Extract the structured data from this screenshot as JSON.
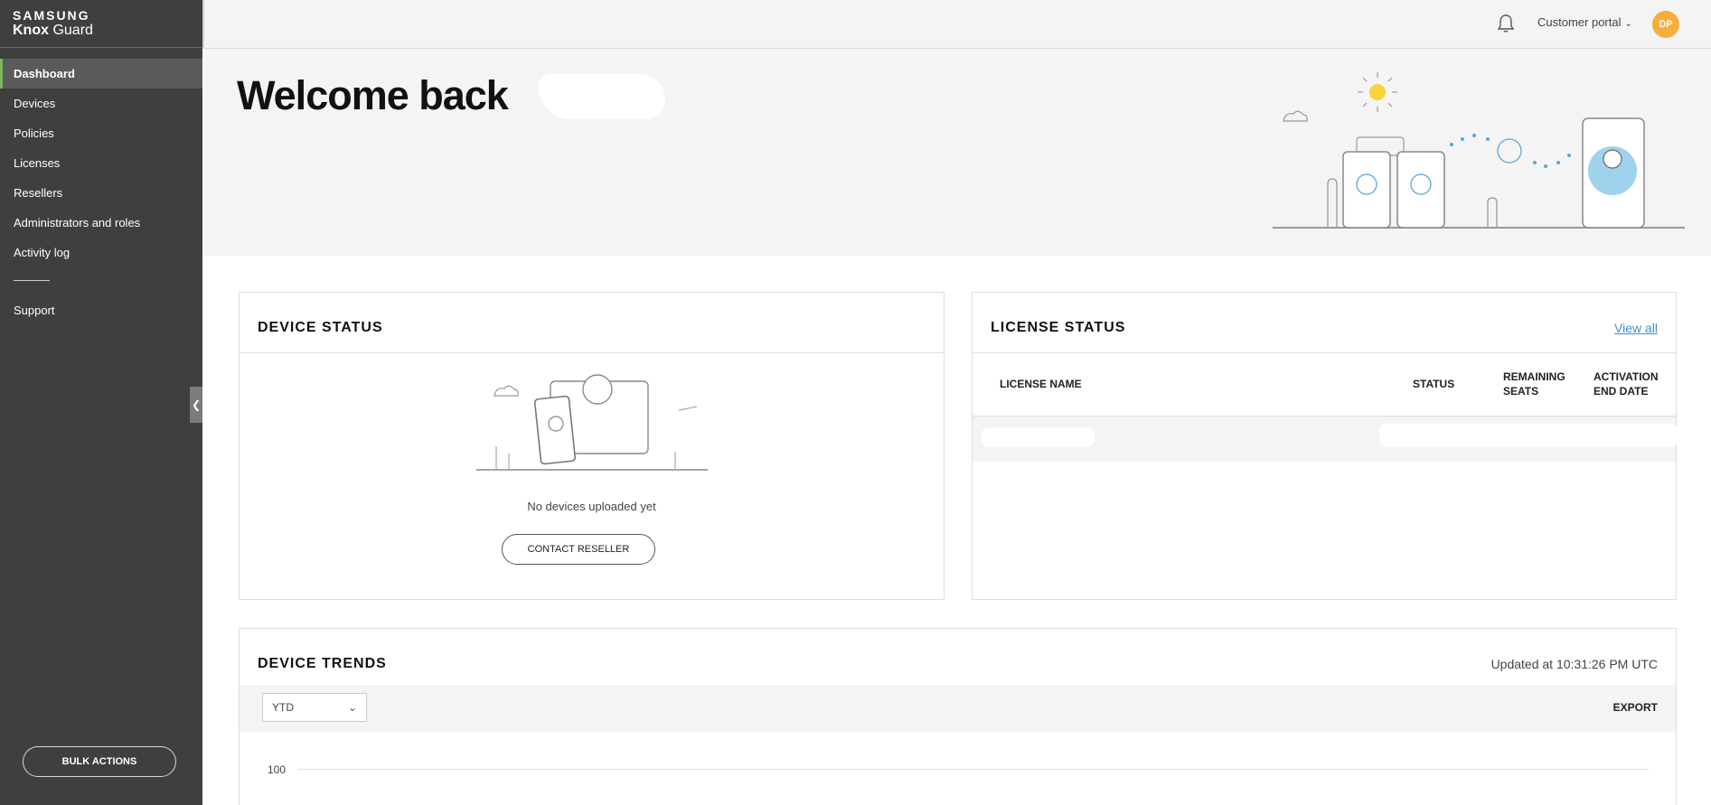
{
  "brand": {
    "top": "SAMSUNG",
    "word1": "Knox",
    "word2": "Guard"
  },
  "sidebar": {
    "items": [
      {
        "label": "Dashboard"
      },
      {
        "label": "Devices"
      },
      {
        "label": "Policies"
      },
      {
        "label": "Licenses"
      },
      {
        "label": "Resellers"
      },
      {
        "label": "Administrators and roles"
      },
      {
        "label": "Activity log"
      },
      {
        "label": "Support"
      }
    ],
    "bulk_actions": "BULK ACTIONS"
  },
  "topbar": {
    "portal": "Customer portal",
    "avatar": "DP"
  },
  "hero": {
    "welcome": "Welcome back"
  },
  "device_status": {
    "title": "DEVICE STATUS",
    "empty_text": "No devices uploaded yet",
    "contact_button": "CONTACT RESELLER"
  },
  "license_status": {
    "title": "LICENSE STATUS",
    "view_all": "View all",
    "columns": [
      "LICENSE NAME",
      "STATUS",
      "REMAINING SEATS",
      "ACTIVATION END DATE"
    ]
  },
  "device_trends": {
    "title": "DEVICE TRENDS",
    "updated": "Updated at 10:31:26 PM UTC",
    "range": "YTD",
    "export": "EXPORT",
    "y_tick": "100"
  },
  "colors": {
    "sidebar": "#3f3f3f",
    "accent": "#f6ad3c",
    "link": "#3d8fd9"
  }
}
